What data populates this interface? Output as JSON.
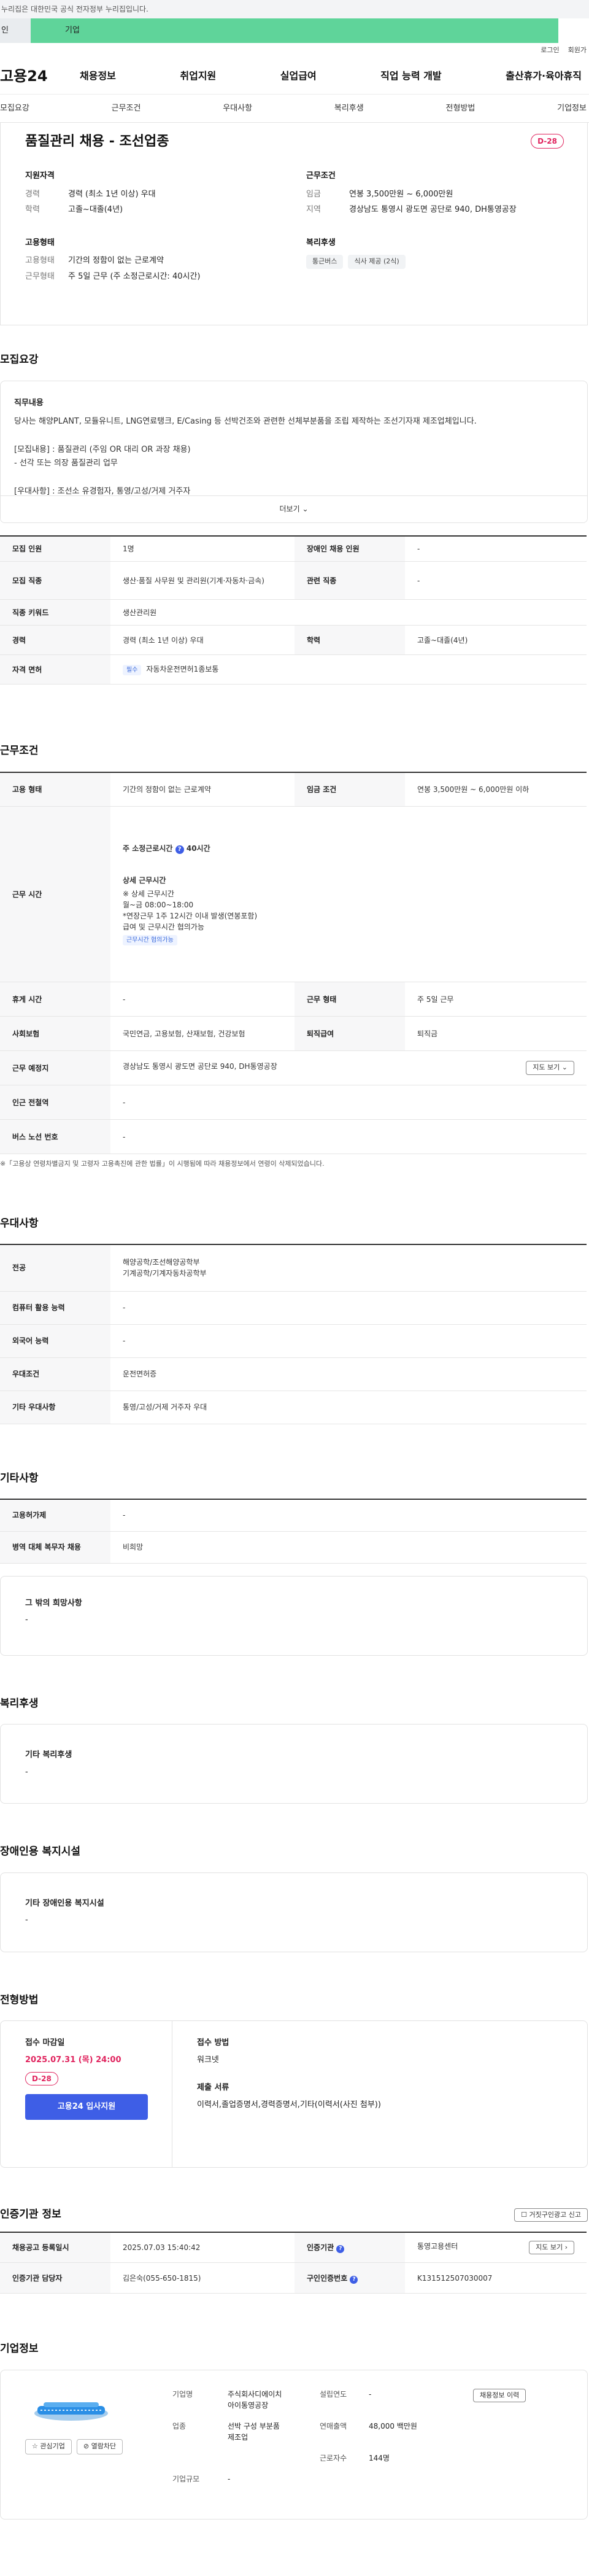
{
  "gov_banner": "누리집은 대한민국 공식 전자정부 누리집입니다.",
  "top_tabs": [
    {
      "label": "인"
    },
    {
      "label": "기업"
    }
  ],
  "util": {
    "login": "로그인",
    "signup": "회원가"
  },
  "logo": "고용24",
  "gnb": [
    "채용정보",
    "취업지원",
    "실업급여",
    "직업 능력 개발",
    "출산휴가·육아휴직"
  ],
  "subnav": [
    "모집요강",
    "근무조건",
    "우대사항",
    "복리후생",
    "전형방법",
    "기업정보"
  ],
  "summary": {
    "title": "품질관리 채용 - 조선업종",
    "dday": "D-28",
    "qualification": {
      "heading": "지원자격",
      "rows": [
        {
          "k": "경력",
          "v": "경력 (최소 1년 이상) 우대"
        },
        {
          "k": "학력",
          "v": "고졸~대졸(4년)"
        }
      ]
    },
    "conditions": {
      "heading": "근무조건",
      "rows": [
        {
          "k": "임금",
          "v": "연봉 3,500만원 ~ 6,000만원"
        },
        {
          "k": "지역",
          "v": "경상남도 통영시 광도면 공단로 940, DH통영공장"
        }
      ]
    },
    "employment": {
      "heading": "고용형태",
      "rows": [
        {
          "k": "고용형태",
          "v": "기간의 정함이 없는 근로계약"
        },
        {
          "k": "근무형태",
          "v": "주 5일 근무 (주 소정근로시간: 40시간)"
        }
      ]
    },
    "welfare": {
      "heading": "복리후생",
      "chips": [
        "통근버스",
        "식사 제공 (2식)"
      ]
    }
  },
  "recruit": {
    "heading": "모집요강",
    "desc_heading": "직무내용",
    "desc_text": "당사는 해양PLANT, 모듈유니트, LNG연료탱크, E/Casing 등 선박건조와 관련한 선체부분품을 조립 제작하는 조선기자재 제조업체입니다.\n\n[모집내용] : 품질관리 (주임 OR 대리 OR 과장 채용)\n          - 선각 또는 의장 품질관리 업무\n\n[우대사항] : 조선소 유경험자, 통영/고성/거제 거주자\n\n\n• 채용대행접수중 •",
    "more": "더보기",
    "table": [
      {
        "k1": "모집 인원",
        "v1": "1명",
        "k2": "장애인 채용 인원",
        "v2": "-"
      },
      {
        "k1": "모집 직종",
        "v1": "생산·품질 사무원 및 관리원(기계·자동차·금속)",
        "k2": "관련 직종",
        "v2": "-"
      },
      {
        "k1": "직종 키워드",
        "v1": "생산관리원"
      },
      {
        "k1": "경력",
        "v1": "경력 (최소 1년 이상) 우대",
        "k2": "학력",
        "v2": "고졸~대졸(4년)"
      },
      {
        "k1": "자격 면허",
        "badge": "필수",
        "v1": "자동차운전면허1종보통"
      }
    ]
  },
  "conditions": {
    "heading": "근무조건",
    "type_k": "고용 형태",
    "type_v": "기간의 정함이 없는 근로계약",
    "wage_k": "임금 조건",
    "wage_v": "연봉 3,500만원 ~ 6,000만원 이하",
    "hours_k": "근무 시간",
    "hours_main": "주 소정근로시간",
    "hours_main_val": "40시간",
    "hours_detail_h": "상세 근무시간",
    "hours_detail_lines": [
      "※ 상세 근무시간",
      "월~금 08:00~18:00",
      "*연장근무 1주 12시간 이내 발생(연봉포함)",
      "급여 및 근무시간 협의가능"
    ],
    "hours_tag": "근무시간 협의가능",
    "rest_k": "휴게 시간",
    "rest_v": "-",
    "form_k": "근무 형태",
    "form_v": "주 5일 근무",
    "ins_k": "사회보험",
    "ins_v": "국민연금, 고용보험, 산재보험, 건강보험",
    "retire_k": "퇴직급여",
    "retire_v": "퇴직금",
    "place_k": "근무 예정지",
    "place_v": "경상남도 통영시 광도면 공단로 940, DH통영공장",
    "map_btn": "지도 보기",
    "metro_k": "인근 전철역",
    "metro_v": "-",
    "bus_k": "버스 노선 번호",
    "bus_v": "-",
    "note": "※「고용상 연령차별금지 및 고령자 고용촉진에 관한 법률」이 시행됨에 따라 채용정보에서 연령이 삭제되었습니다."
  },
  "preference": {
    "heading": "우대사항",
    "rows": [
      {
        "k": "전공",
        "v": "해양공학/조선해양공학부\n기계공학/기계자동차공학부"
      },
      {
        "k": "컴퓨터 활용 능력",
        "v": "-"
      },
      {
        "k": "외국어 능력",
        "v": "-"
      },
      {
        "k": "우대조건",
        "v": "운전면허증"
      },
      {
        "k": "기타 우대사항",
        "v": "통영/고성/거제 거주자 우대"
      }
    ]
  },
  "etc": {
    "heading": "기타사항",
    "rows": [
      {
        "k": "고용허가제",
        "v": "-"
      },
      {
        "k": "병역 대체 복무자 채용",
        "v": "비희망"
      }
    ],
    "box_h": "그 밖의 희망사항",
    "box_v": "-"
  },
  "welfare": {
    "heading": "복리후생",
    "box_h": "기타 복리후생",
    "box_v": "-"
  },
  "disabled": {
    "heading": "장애인용 복지시설",
    "box_h": "기타 장애인용 복지시설",
    "box_v": "-"
  },
  "apply": {
    "heading": "전형방법",
    "deadline_h": "접수 마감일",
    "deadline": "2025.07.31 (목) 24:00",
    "dday": "D-28",
    "apply_btn": "고용24 입사지원",
    "method_h": "접수 방법",
    "method_v": "워크넷",
    "docs_h": "제출 서류",
    "docs_v": "이력서,졸업증명서,경력증명서,기타(이력서(사진 첨부))"
  },
  "cert": {
    "heading": "인증기관 정보",
    "report_btn": "거짓구인광고 신고",
    "reg_k": "채용공고 등록일시",
    "reg_v": "2025.07.03 15:40:42",
    "org_k": "인증기관",
    "org_v": "통영고용센터",
    "map_btn": "지도 보기",
    "mgr_k": "인증기관 담당자",
    "mgr_v": "김은숙(055-650-1815)",
    "num_k": "구인인증번호",
    "num_v": "K131512507030007"
  },
  "company": {
    "heading": "기업정보",
    "fav_btn": "관심기업",
    "block_btn": "열람차단",
    "name_k": "기업명",
    "name_v": "주식회사디에이치\n아이통영공장",
    "founded_k": "설립연도",
    "founded_v": "-",
    "history_btn": "채용정보 이력",
    "industry_k": "업종",
    "industry_v": "선박 구성 부분품\n제조업",
    "sales_k": "연매출액",
    "sales_v": "48,000 백만원",
    "emp_k": "근로자수",
    "emp_v": "144명",
    "size_k": "기업규모",
    "size_v": "-"
  }
}
